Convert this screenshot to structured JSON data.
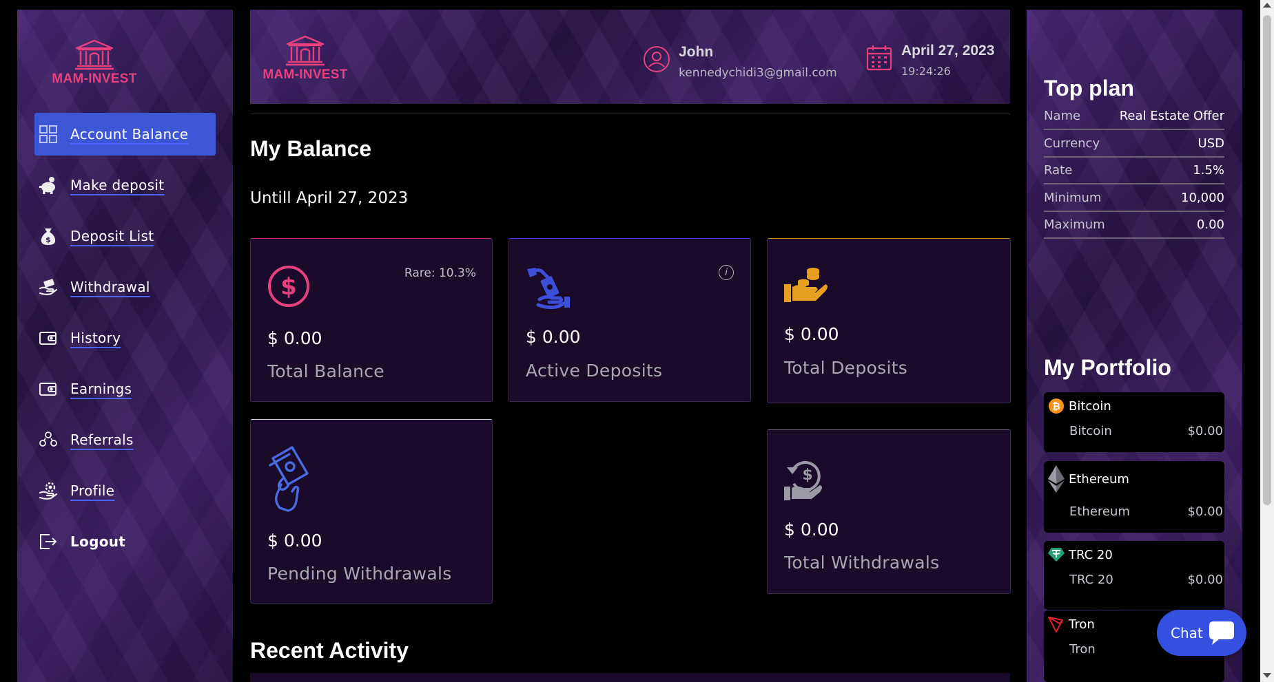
{
  "brand": {
    "name": "MAM-INVEST",
    "accent": "#e8407e"
  },
  "sidebar": {
    "items": [
      {
        "label": "Account Balance",
        "icon": "grid-icon",
        "active": true
      },
      {
        "label": "Make deposit",
        "icon": "piggy-bank-icon"
      },
      {
        "label": "Deposit List",
        "icon": "money-bag-icon"
      },
      {
        "label": "Withdrawal",
        "icon": "hand-cash-icon"
      },
      {
        "label": "History",
        "icon": "wallet-icon"
      },
      {
        "label": "Earnings",
        "icon": "wallet-icon"
      },
      {
        "label": "Referrals",
        "icon": "users-icon"
      },
      {
        "label": "Profile",
        "icon": "profile-gear-icon"
      },
      {
        "label": "Logout",
        "icon": "logout-icon"
      }
    ]
  },
  "header": {
    "user_name": "John",
    "user_email": "kennedychidi3@gmail.com",
    "date": "April 27, 2023",
    "time": "19:24:26"
  },
  "main": {
    "title": "My Balance",
    "until": "Untill April 27, 2023",
    "cards": {
      "total_balance": {
        "amount": "$ 0.00",
        "label": "Total Balance",
        "rate": "Rare: 10.3%",
        "icon": "dollar-circle-icon"
      },
      "active_deposits": {
        "amount": "$ 0.00",
        "label": "Active Deposits",
        "icon": "hand-money-icon"
      },
      "total_deposits": {
        "amount": "$ 0.00",
        "label": "Total Deposits",
        "icon": "coins-hand-icon"
      },
      "pending_withdrawals": {
        "amount": "$ 0.00",
        "label": "Pending Withdrawals",
        "icon": "banknote-hand-icon"
      },
      "total_withdrawals": {
        "amount": "$ 0.00",
        "label": "Total Withdrawals",
        "icon": "refund-hand-icon"
      }
    },
    "recent_title": "Recent Activity"
  },
  "top_plan": {
    "title": "Top plan",
    "rows": [
      {
        "key": "Name",
        "value": "Real Estate Offer"
      },
      {
        "key": "Currency",
        "value": "USD"
      },
      {
        "key": "Rate",
        "value": "1.5%"
      },
      {
        "key": "Minimum",
        "value": "10,000"
      },
      {
        "key": "Maximum",
        "value": "0.00"
      }
    ]
  },
  "portfolio": {
    "title": "My Portfolio",
    "items": [
      {
        "coin": "Bitcoin",
        "name": "Bitcoin",
        "value": "$0.00",
        "icon": "bitcoin-icon"
      },
      {
        "coin": "Ethereum",
        "name": "Ethereum",
        "value": "$0.00",
        "icon": "ethereum-icon"
      },
      {
        "coin": "TRC 20",
        "name": "TRC 20",
        "value": "$0.00",
        "icon": "tether-icon"
      },
      {
        "coin": "Tron",
        "name": "Tron",
        "value": "",
        "icon": "tron-icon"
      }
    ]
  },
  "chat": {
    "label": "Chat"
  }
}
